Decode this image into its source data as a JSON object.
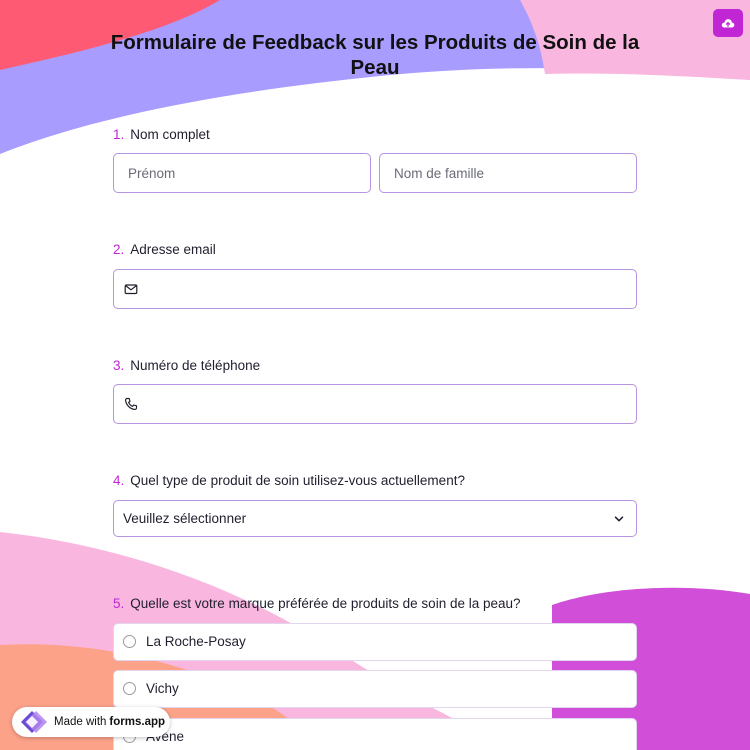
{
  "colors": {
    "accent": "#c026d3",
    "field_border": "#b794e0",
    "bg_purple": "#a89cff",
    "bg_pink": "#f9b6df",
    "bg_red": "#ff5a73",
    "bg_magenta": "#d04ed8",
    "bg_peach": "#fca289"
  },
  "header": {
    "title": "Formulaire de Feedback sur les Produits de Soin de la Peau",
    "upload_icon": "cloud-upload-icon"
  },
  "questions": {
    "q1": {
      "number": "1.",
      "label": "Nom complet",
      "first_name_placeholder": "Prénom",
      "last_name_placeholder": "Nom de famille"
    },
    "q2": {
      "number": "2.",
      "label": "Adresse email",
      "icon": "envelope-icon",
      "value": ""
    },
    "q3": {
      "number": "3.",
      "label": "Numéro de téléphone",
      "icon": "phone-icon",
      "value": ""
    },
    "q4": {
      "number": "4.",
      "label": "Quel type de produit de soin utilisez-vous actuellement?",
      "selected": "Veuillez sélectionner",
      "icon": "chevron-down-icon"
    },
    "q5": {
      "number": "5.",
      "label": "Quelle est votre marque préférée de produits de soin de la peau?",
      "options": [
        "La Roche-Posay",
        "Vichy",
        "Avène"
      ]
    }
  },
  "badge": {
    "prefix": "Made with",
    "brand": "forms.app"
  }
}
